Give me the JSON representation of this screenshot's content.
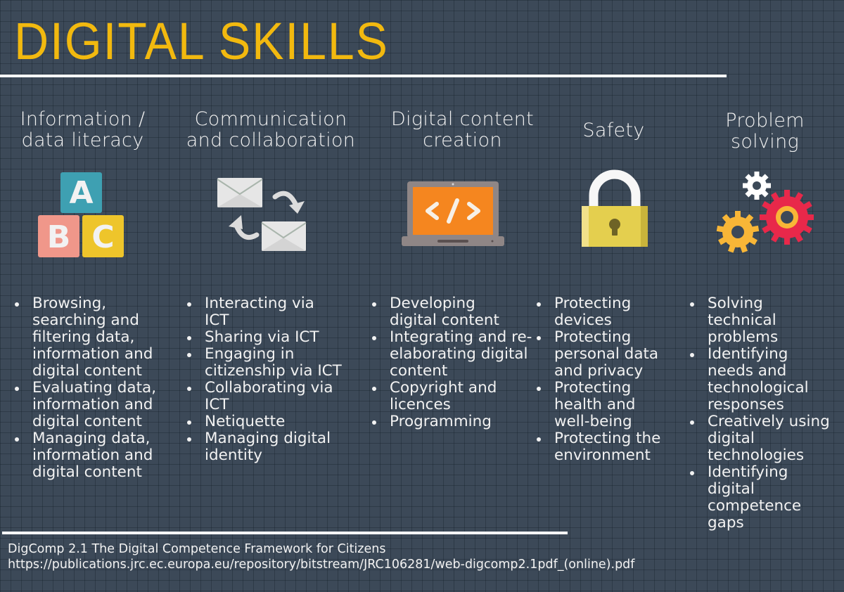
{
  "title": "DIGITAL SKILLS",
  "colors": {
    "title": "#f2b90f",
    "background": "#3c4958",
    "text": "#f2f2f2"
  },
  "areas": [
    {
      "heading_lines": [
        "Information /",
        "data literacy"
      ],
      "icon": "abc-blocks-icon",
      "items": [
        "Browsing, searching and filtering data, information and digital content",
        "Evaluating data, information and digital content",
        "Managing data, information and digital content"
      ]
    },
    {
      "heading_lines": [
        "Communication",
        "and collaboration"
      ],
      "icon": "envelopes-exchange-icon",
      "items": [
        "Interacting via ICT",
        "Sharing via ICT",
        "Engaging in citizenship via ICT",
        "Collaborating via ICT",
        "Netiquette",
        "Managing digital identity"
      ]
    },
    {
      "heading_lines": [
        "Digital content",
        "creation"
      ],
      "icon": "laptop-code-icon",
      "icon_code_glyph": "</>",
      "items": [
        "Developing digital content",
        "Integrating and re-elaborating digital content",
        "Copyright and licences",
        "Programming"
      ]
    },
    {
      "heading_lines": [
        "Safety"
      ],
      "icon": "padlock-icon",
      "items": [
        "Protecting devices",
        "Protecting personal data and privacy",
        "Protecting health and well-being",
        "Protecting the environment"
      ]
    },
    {
      "heading_lines": [
        "Problem",
        "solving"
      ],
      "icon": "gears-icon",
      "items": [
        "Solving technical problems",
        "Identifying needs and technological responses",
        "Creatively using digital technologies",
        "Identifying digital competence gaps"
      ]
    }
  ],
  "footer": {
    "line1": "DigComp 2.1 The Digital Competence Framework for Citizens",
    "line2": "https://publications.jrc.ec.europa.eu/repository/bitstream/JRC106281/web-digcomp2.1pdf_(online).pdf"
  }
}
